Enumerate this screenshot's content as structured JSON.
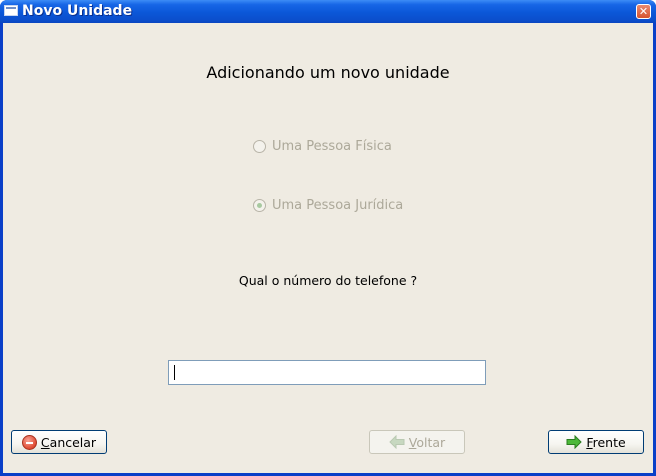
{
  "window": {
    "title": "Novo Unidade",
    "close_symbol": "✕"
  },
  "heading": "Adicionando um novo unidade",
  "options": [
    {
      "label": "Uma Pessoa Física",
      "checked": false,
      "enabled": false
    },
    {
      "label": "Uma Pessoa Jurídica",
      "checked": true,
      "enabled": false
    }
  ],
  "question": "Qual o número do telefone ?",
  "phone_input": {
    "value": "",
    "placeholder": ""
  },
  "buttons": {
    "cancel": {
      "mnemonic": "C",
      "rest": "ancelar",
      "icon": "cancel-icon",
      "enabled": true
    },
    "back": {
      "mnemonic": "V",
      "rest": "oltar",
      "icon": "arrow-left-icon",
      "enabled": false
    },
    "next": {
      "mnemonic": "F",
      "rest": "rente",
      "icon": "arrow-right-icon",
      "enabled": true
    }
  },
  "colors": {
    "titlebar": "#0b57d8",
    "dialog_bg": "#efebe2",
    "input_border": "#7f9db9",
    "disabled_text": "#aca899"
  }
}
